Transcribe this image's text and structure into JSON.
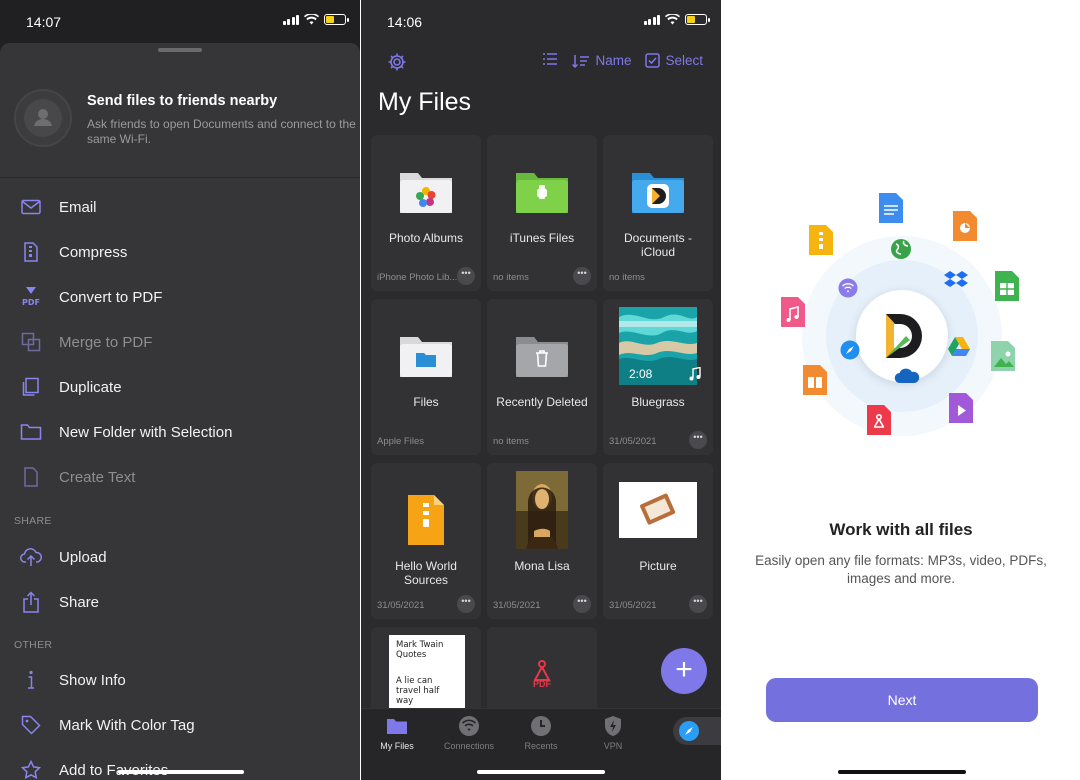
{
  "left_panel": {
    "status": {
      "time": "14:07"
    },
    "nearby": {
      "title": "Send files to friends nearby",
      "subtitle": "Ask friends to open Documents and connect to the same Wi-Fi."
    },
    "actions": [
      {
        "label": "Email",
        "icon": "envelope-icon",
        "dim": false
      },
      {
        "label": "Compress",
        "icon": "zip-icon",
        "dim": false
      },
      {
        "label": "Convert to PDF",
        "icon": "pdf-icon",
        "dim": false
      },
      {
        "label": "Merge to PDF",
        "icon": "merge-icon",
        "dim": true
      },
      {
        "label": "Duplicate",
        "icon": "duplicate-icon",
        "dim": false
      },
      {
        "label": "New Folder with Selection",
        "icon": "folder-icon",
        "dim": false
      },
      {
        "label": "Create Text",
        "icon": "text-icon",
        "dim": true
      }
    ],
    "share_header": "SHARE",
    "share_actions": [
      {
        "label": "Upload",
        "icon": "upload-icon"
      },
      {
        "label": "Share",
        "icon": "share-icon"
      }
    ],
    "other_header": "OTHER",
    "other_actions": [
      {
        "label": "Show Info",
        "icon": "info-icon"
      },
      {
        "label": "Mark With Color Tag",
        "icon": "tag-icon"
      },
      {
        "label": "Add to Favorites",
        "icon": "star-icon"
      }
    ]
  },
  "middle_panel": {
    "status": {
      "time": "14:06"
    },
    "toolbar": {
      "sort_label": "Name",
      "select_label": "Select"
    },
    "title": "My Files",
    "items": [
      {
        "name": "Photo Albums",
        "sub": "iPhone Photo Lib...",
        "thumb": "photos-folder",
        "more": true
      },
      {
        "name": "iTunes Files",
        "sub": "no items",
        "thumb": "itunes-folder",
        "more": true
      },
      {
        "name": "Documents - iCloud",
        "sub": "no items",
        "thumb": "icloud-folder",
        "more": false
      },
      {
        "name": "Files",
        "sub": "Apple Files",
        "thumb": "files-folder",
        "more": false
      },
      {
        "name": "Recently Deleted",
        "sub": "no items",
        "thumb": "trash-folder",
        "more": false
      },
      {
        "name": "Bluegrass",
        "sub": "31/05/2021",
        "thumb": "video",
        "duration": "2:08",
        "more": true
      },
      {
        "name": "Hello World Sources",
        "sub": "31/05/2021",
        "thumb": "zip",
        "more": true
      },
      {
        "name": "Mona Lisa",
        "sub": "31/05/2021",
        "thumb": "painting",
        "more": true
      },
      {
        "name": "Picture",
        "sub": "31/05/2021",
        "thumb": "picture",
        "more": true
      },
      {
        "name": "",
        "sub": "",
        "thumb": "text-doc",
        "doc_title": "Mark Twain Quotes",
        "doc_body": "A lie can travel half way",
        "more": false
      },
      {
        "name": "",
        "sub": "",
        "thumb": "pdf",
        "pdf_label": "PDF",
        "more": false
      }
    ],
    "tabs": [
      {
        "label": "My Files",
        "icon": "folder-icon",
        "active": true
      },
      {
        "label": "Connections",
        "icon": "wifi-icon",
        "active": false
      },
      {
        "label": "Recents",
        "icon": "clock-icon",
        "active": false
      },
      {
        "label": "VPN",
        "icon": "shield-icon",
        "active": false
      }
    ],
    "accent": "#7e78e8"
  },
  "right_panel": {
    "heading": "Work with all files",
    "description": "Easily open any file formats: MP3s, video, PDFs, images and more.",
    "next_label": "Next",
    "accent": "#7470de"
  }
}
